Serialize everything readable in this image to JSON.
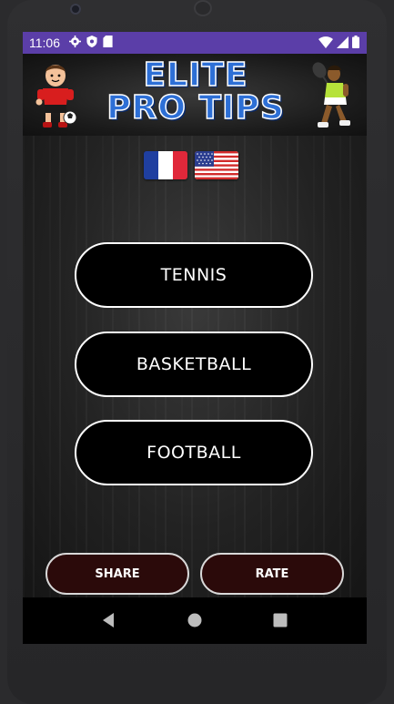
{
  "status_bar": {
    "time": "11:06",
    "left_icons": [
      "gear-icon",
      "shield-icon",
      "sd-card-icon"
    ],
    "right_icons": [
      "wifi-icon",
      "signal-icon",
      "battery-icon"
    ],
    "color": "#5b3ea8"
  },
  "banner": {
    "title_line1": "ELITE",
    "title_line2": "PRO TIPS",
    "left_mascot": "soccer-player-icon",
    "right_mascot": "tennis-player-icon"
  },
  "languages": [
    {
      "name": "french-flag-icon"
    },
    {
      "name": "us-flag-icon"
    }
  ],
  "sports": [
    {
      "label": "TENNIS"
    },
    {
      "label": "BASKETBALL"
    },
    {
      "label": "FOOTBALL"
    }
  ],
  "actions": {
    "share": "SHARE",
    "rate": "RATE"
  },
  "nav": [
    "back-icon",
    "home-icon",
    "recents-icon"
  ]
}
